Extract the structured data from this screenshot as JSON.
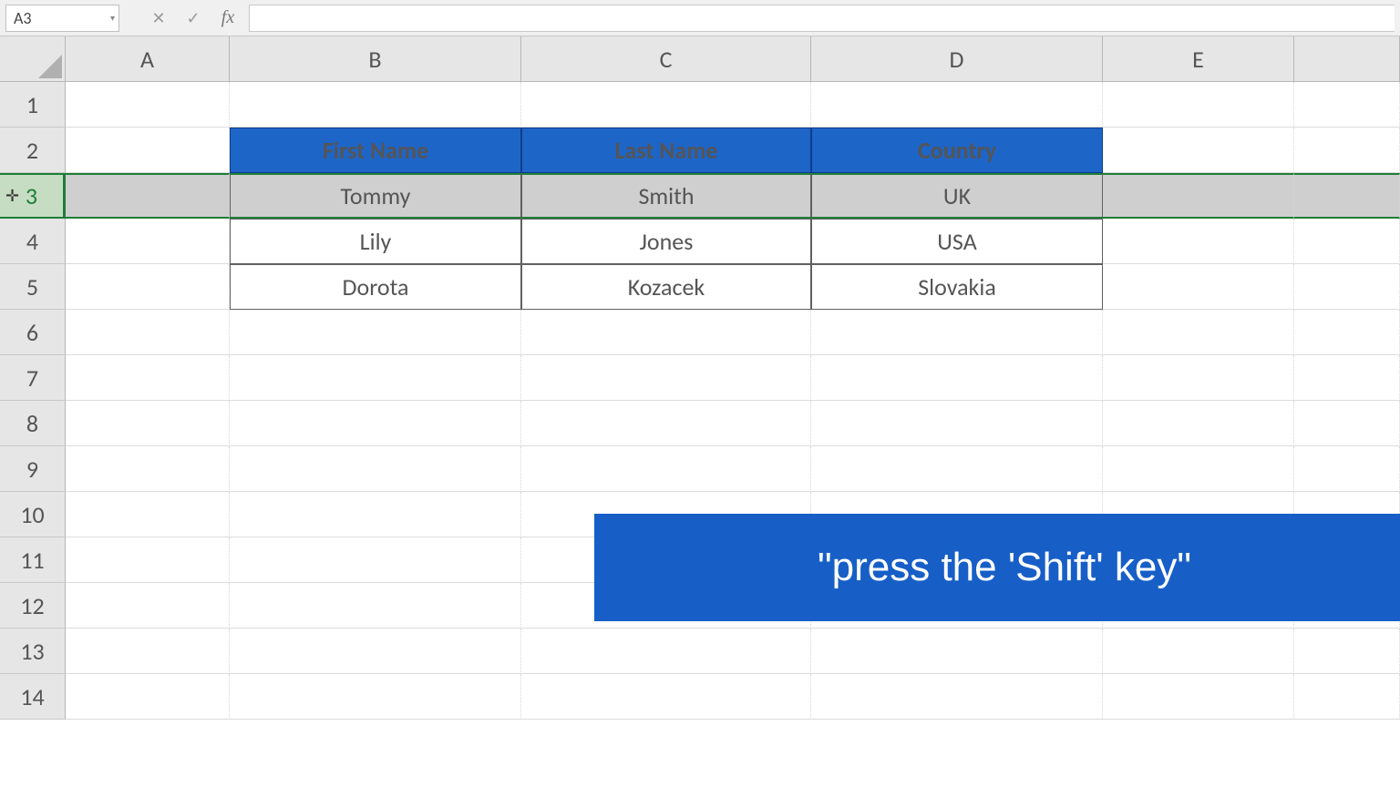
{
  "formula_bar": {
    "name_box": "A3",
    "cancel_icon": "✕",
    "enter_icon": "✓",
    "fx_label": "fx",
    "formula_value": ""
  },
  "columns": [
    "A",
    "B",
    "C",
    "D",
    "E"
  ],
  "rows": [
    "1",
    "2",
    "3",
    "4",
    "5",
    "6",
    "7",
    "8",
    "9",
    "10",
    "11",
    "12",
    "13",
    "14"
  ],
  "selected_row": "3",
  "table": {
    "headers": [
      "First Name",
      "Last Name",
      "Country"
    ],
    "rows": [
      {
        "first": "Tommy",
        "last": "Smith",
        "country": "UK"
      },
      {
        "first": "Lily",
        "last": "Jones",
        "country": "USA"
      },
      {
        "first": "Dorota",
        "last": "Kozacek",
        "country": "Slovakia"
      }
    ]
  },
  "callout_text": "\"press the 'Shift' key\"",
  "cursor_glyph": "✛"
}
